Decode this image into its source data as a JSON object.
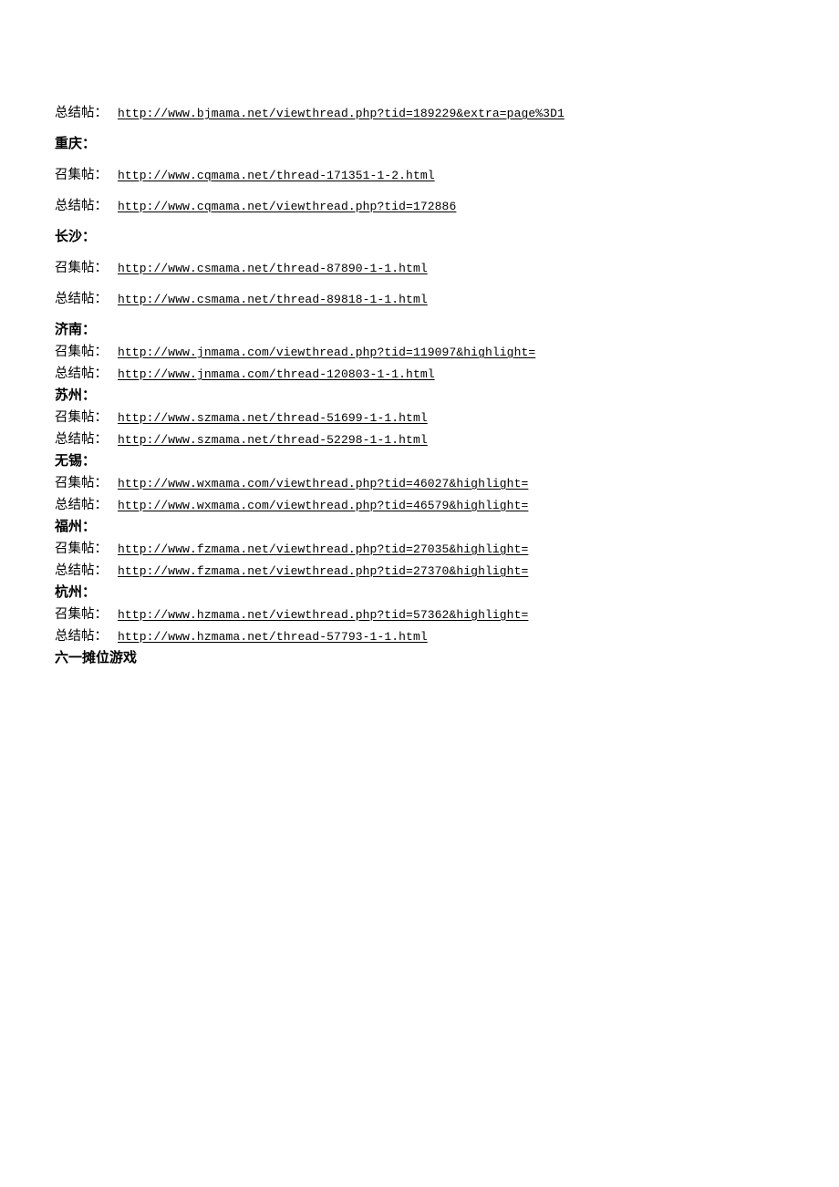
{
  "document": {
    "labels": {
      "call_post": "召集帖：",
      "summary_post": "总结帖："
    },
    "orphan_first_line": {
      "label": "总结帖：",
      "url": "http://www.bjmama.net/viewthread.php?tid=189229&extra=page%3D1"
    },
    "sections": [
      {
        "city": "重庆：",
        "spacing": "loose",
        "rows": [
          {
            "label": "召集帖：",
            "url": "http://www.cqmama.net/thread-171351-1-2.html"
          },
          {
            "label": "总结帖：",
            "url": "http://www.cqmama.net/viewthread.php?tid=172886"
          }
        ]
      },
      {
        "city": "长沙：",
        "spacing": "loose",
        "rows": [
          {
            "label": "召集帖：",
            "url": "http://www.csmama.net/thread-87890-1-1.html"
          },
          {
            "label": "总结帖：",
            "url": "http://www.csmama.net/thread-89818-1-1.html"
          }
        ]
      },
      {
        "city": "济南：",
        "spacing": "tight",
        "rows": [
          {
            "label": "召集帖：",
            "url": "http://www.jnmama.com/viewthread.php?tid=119097&highlight="
          },
          {
            "label": "总结帖：",
            "url": "http://www.jnmama.com/thread-120803-1-1.html"
          }
        ]
      },
      {
        "city": "苏州：",
        "spacing": "tight",
        "rows": [
          {
            "label": "召集帖：",
            "url": "http://www.szmama.net/thread-51699-1-1.html"
          },
          {
            "label": "总结帖：",
            "url": "http://www.szmama.net/thread-52298-1-1.html"
          }
        ]
      },
      {
        "city": "无锡：",
        "spacing": "tight",
        "rows": [
          {
            "label": "召集帖：",
            "url": "http://www.wxmama.com/viewthread.php?tid=46027&highlight="
          },
          {
            "label": "总结帖：",
            "url": "http://www.wxmama.com/viewthread.php?tid=46579&highlight="
          }
        ]
      },
      {
        "city": "福州：",
        "spacing": "tight",
        "rows": [
          {
            "label": "召集帖：",
            "url": "http://www.fzmama.net/viewthread.php?tid=27035&highlight="
          },
          {
            "label": "总结帖：",
            "url": "http://www.fzmama.net/viewthread.php?tid=27370&highlight="
          }
        ]
      },
      {
        "city": "杭州：",
        "spacing": "tight",
        "rows": [
          {
            "label": "召集帖：",
            "url": "http://www.hzmama.net/viewthread.php?tid=57362&highlight="
          },
          {
            "label": "总结帖：",
            "url": "http://www.hzmama.net/thread-57793-1-1.html"
          }
        ]
      }
    ],
    "closing_heading": "六一摊位游戏"
  }
}
